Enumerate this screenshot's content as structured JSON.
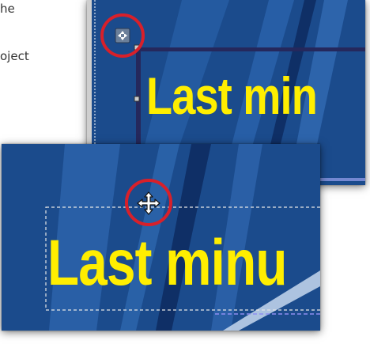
{
  "instructions": {
    "line1": "he",
    "line2": "oject"
  },
  "top_shot": {
    "headline": "Last min"
  },
  "bottom_shot": {
    "headline": "Last minu"
  },
  "colors": {
    "banner_bg": "#1b4b8c",
    "banner_dark": "#0f2f66",
    "text_yellow": "#ffee00",
    "highlight_red": "#d8202a"
  },
  "icons": {
    "top_cursor": "move-handle-icon",
    "bottom_cursor": "move-cursor-icon"
  }
}
